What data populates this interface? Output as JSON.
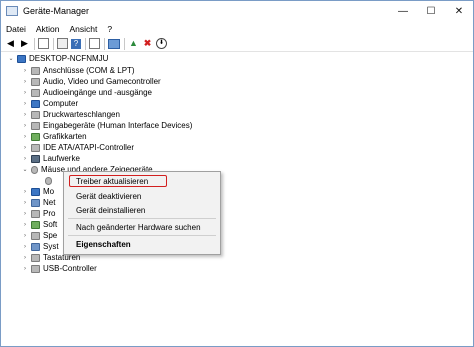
{
  "window": {
    "title": "Geräte-Manager",
    "minimize": "—",
    "maximize": "☐",
    "close": "✕"
  },
  "menu": [
    "Datei",
    "Aktion",
    "Ansicht",
    "?"
  ],
  "toolbar": {
    "icons": [
      "back-icon",
      "forward-icon",
      "show-hidden-icon",
      "properties-icon",
      "help-icon",
      "view-icon",
      "monitor-icon",
      "update-driver-icon",
      "remove-icon",
      "download-icon"
    ],
    "remove_color": "#d21f1f",
    "update_color": "#2c8a3c"
  },
  "tree": {
    "root": "DESKTOP-NCFNMJU",
    "items": [
      {
        "label": "Anschlüsse (COM & LPT)",
        "expander": "›"
      },
      {
        "label": "Audio, Video und Gamecontroller",
        "expander": "›"
      },
      {
        "label": "Audioeingänge und -ausgänge",
        "expander": "›"
      },
      {
        "label": "Computer",
        "expander": "›"
      },
      {
        "label": "Druckwarteschlangen",
        "expander": "›"
      },
      {
        "label": "Eingabegeräte (Human Interface Devices)",
        "expander": "›"
      },
      {
        "label": "Grafikkarten",
        "expander": "›"
      },
      {
        "label": "IDE ATA/ATAPI-Controller",
        "expander": "›"
      },
      {
        "label": "Laufwerke",
        "expander": "›"
      },
      {
        "label": "Mäuse und andere Zeigegeräte",
        "expander": "⌄"
      },
      {
        "label": "",
        "expander": ""
      },
      {
        "label": "Mo",
        "expander": "›"
      },
      {
        "label": "Net",
        "expander": "›"
      },
      {
        "label": "Pro",
        "expander": "›"
      },
      {
        "label": "Soft",
        "expander": "›"
      },
      {
        "label": "Spe",
        "expander": "›"
      },
      {
        "label": "Syst",
        "expander": "›"
      },
      {
        "label": "Tastaturen",
        "expander": "›"
      },
      {
        "label": "USB-Controller",
        "expander": "›"
      }
    ]
  },
  "context_menu": {
    "items": [
      "Treiber aktualisieren",
      "Gerät deaktivieren",
      "Gerät deinstallieren",
      "Nach geänderter Hardware suchen",
      "Eigenschaften"
    ],
    "highlight_color": "#d21f1f"
  }
}
